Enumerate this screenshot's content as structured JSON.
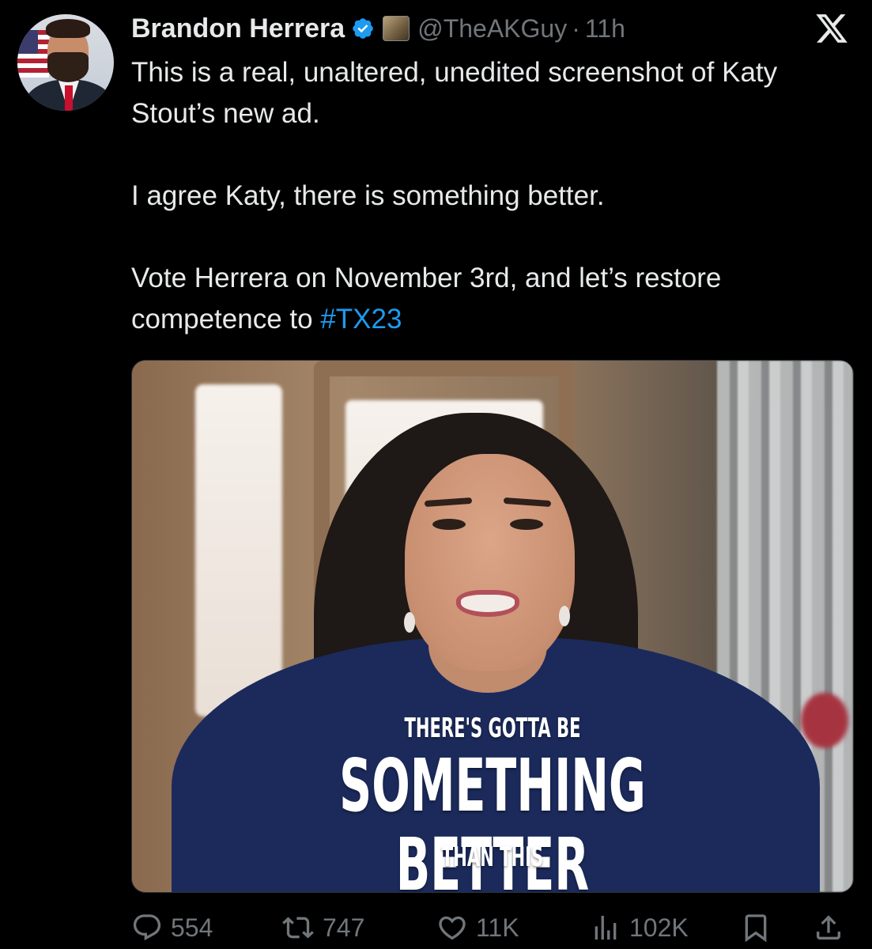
{
  "colors": {
    "background": "#000000",
    "text": "#e7e9ea",
    "muted": "#71767b",
    "link": "#1d9bf0",
    "verified": "#1d9bf0"
  },
  "header": {
    "name": "Brandon Herrera",
    "handle": "@TheAKGuy",
    "separator": "·",
    "time": "11h",
    "icons": [
      "verified-badge-icon",
      "affiliate-badge-icon",
      "x-logo-icon"
    ]
  },
  "tweet": {
    "line1": "This is a real, unaltered, unedited screenshot of Katy Stout’s new ad.",
    "line2": "I agree Katy, there is something better.",
    "line3_prefix": "Vote Herrera on November 3rd, and let’s restore competence to ",
    "hashtag": "#TX23"
  },
  "media": {
    "caption_top": "THERE'S GOTTA BE",
    "caption_main": "SOMETHING BETTER",
    "caption_bottom": "THAN THIS"
  },
  "actions": {
    "replies": "554",
    "reposts": "747",
    "likes": "11K",
    "views": "102K",
    "icons": [
      "reply-icon",
      "repost-icon",
      "like-icon",
      "views-icon",
      "bookmark-icon",
      "share-icon"
    ]
  }
}
